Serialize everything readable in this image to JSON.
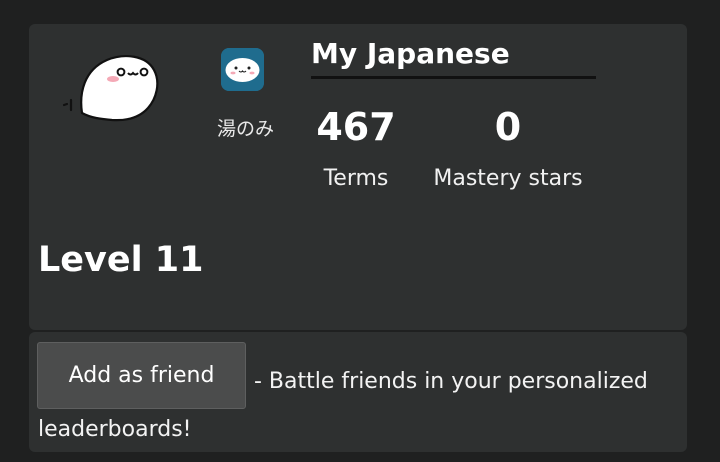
{
  "profile": {
    "app_name": "湯のみ",
    "title": "My Japanese",
    "level_label": "Level 11"
  },
  "stats": [
    {
      "value": "467",
      "label": "Terms"
    },
    {
      "value": "0",
      "label": "Mastery stars"
    }
  ],
  "friend": {
    "button_label": "Add as friend",
    "description": "- Battle friends in your personalized leaderboards!"
  },
  "icons": {
    "mascot": "ghost-mascot-icon",
    "app": "app-face-icon"
  },
  "colors": {
    "background": "#1f2020",
    "card": "#2e3030",
    "app_icon": "#1f6c8e",
    "button": "#4b4c4c",
    "text": "#ffffff"
  }
}
